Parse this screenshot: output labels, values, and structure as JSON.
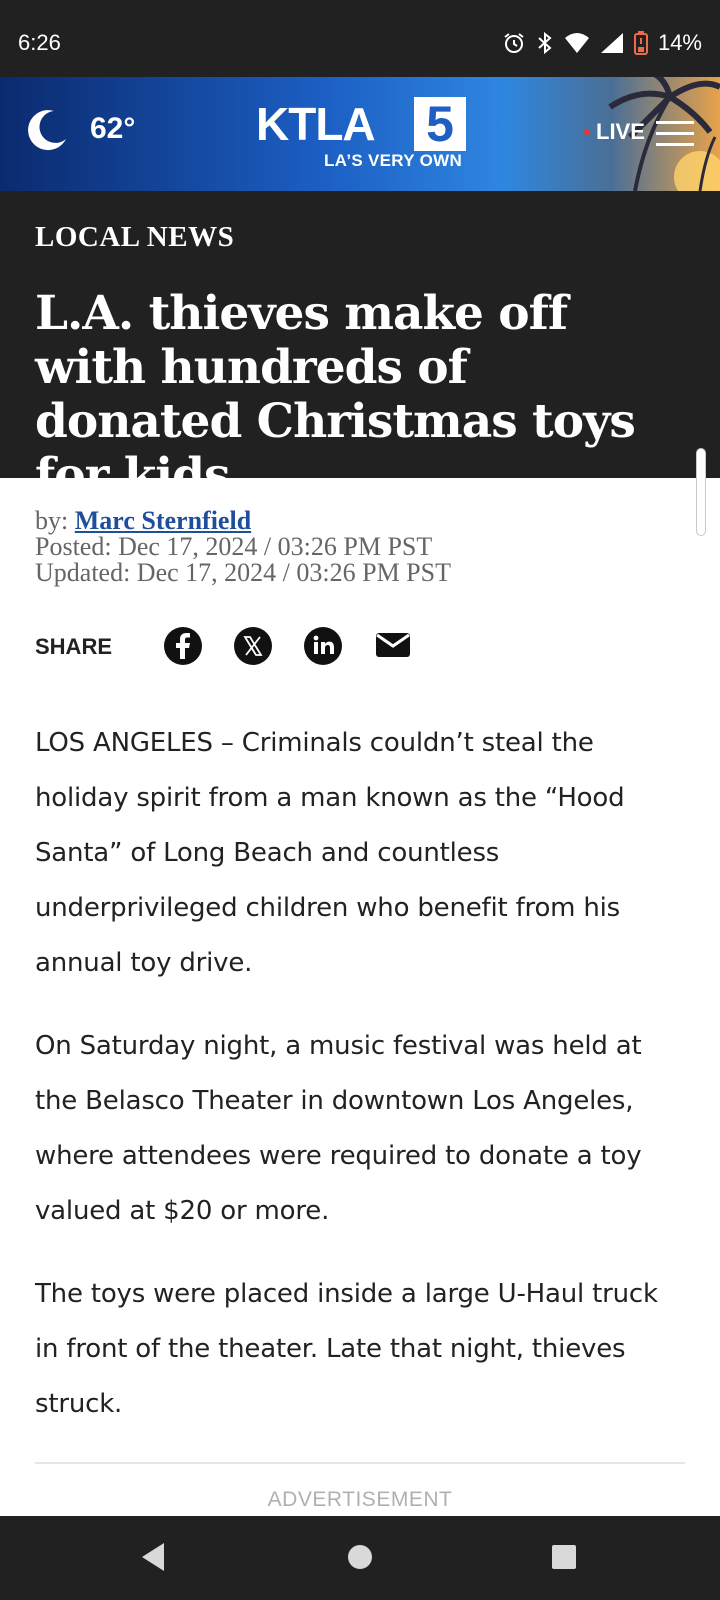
{
  "status_bar": {
    "time": "6:26",
    "battery": "14%"
  },
  "header": {
    "weather_temp": "62°",
    "logo_letters": "KTLA",
    "logo_number": "5",
    "logo_tagline": "LA’S VERY OWN",
    "live_label": "LIVE",
    "accent_colors": {
      "live_dot": "#e53935",
      "header_blue": "#1c5fc4"
    }
  },
  "article_header": {
    "section": "LOCAL NEWS",
    "headline": "L.A. thieves make off with hundreds of donated Christmas toys for kids"
  },
  "byline": {
    "by_prefix": "by:",
    "author": "Marc Sternfield",
    "posted": "Posted: Dec 17, 2024 / 03:26 PM PST",
    "updated": "Updated: Dec 17, 2024 / 03:26 PM PST"
  },
  "share": {
    "label": "SHARE",
    "icons": [
      "facebook-icon",
      "x-icon",
      "linkedin-icon",
      "email-icon"
    ]
  },
  "article": {
    "paragraphs": [
      "LOS ANGELES – Criminals couldn’t steal the holiday spirit from a man known as the “Hood Santa” of Long Beach and countless underprivileged children who benefit from his annual toy drive.",
      "On Saturday night, a music festival was held at the Belasco Theater in downtown Los Angeles, where attendees were required to donate a toy valued at $20 or more.",
      "The toys were placed inside a large U-Haul truck in front of the theater. Late that night, thieves struck."
    ],
    "ad_label": "ADVERTISEMENT"
  },
  "nav_bar": {
    "buttons": [
      "back-icon",
      "home-icon",
      "recents-icon"
    ]
  }
}
